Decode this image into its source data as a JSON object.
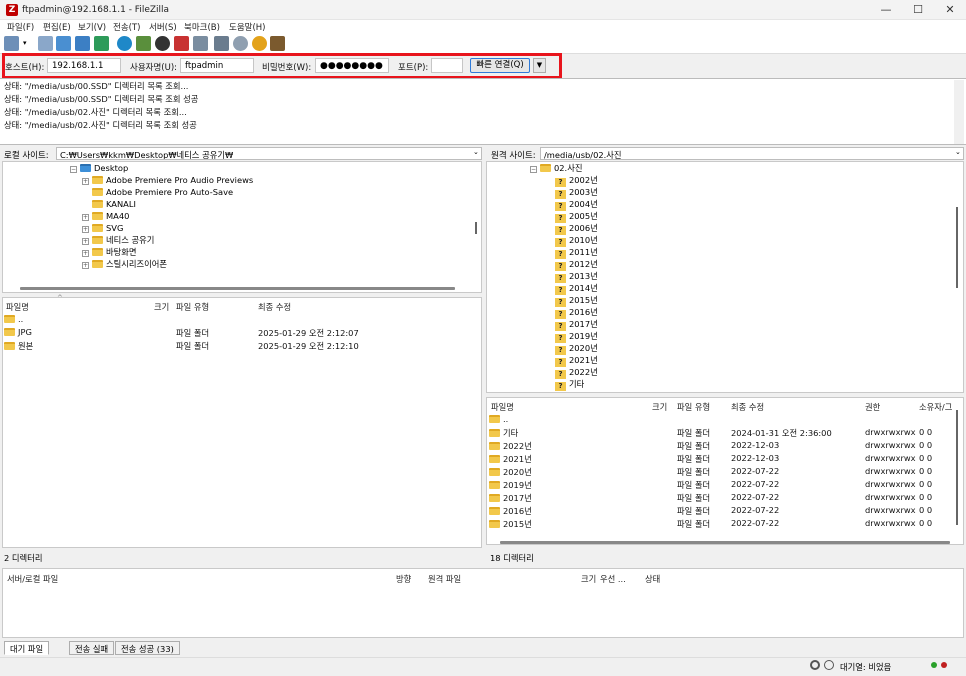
{
  "window": {
    "title": "ftpadmin@192.168.1.1 - FileZilla",
    "app_icon": "Z",
    "minimize": "—",
    "maximize": "☐",
    "close": "✕"
  },
  "menu": [
    "파일(F)",
    "편집(E)",
    "보기(V)",
    "전송(T)",
    "서버(S)",
    "북마크(B)",
    "도움말(H)"
  ],
  "quickconnect": {
    "host_label": "호스트(H):",
    "host_value": "192.168.1.1",
    "user_label": "사용자명(U):",
    "user_value": "ftpadmin",
    "pass_label": "비밀번호(W):",
    "pass_value": "●●●●●●●●",
    "port_label": "포트(P):",
    "port_value": "",
    "connect_label": "빠른 연결(Q)",
    "dropdown": "▼"
  },
  "log": [
    "상태:  \"/media/usb/00.SSD\" 디렉터리 목록 조회...",
    "상태:  \"/media/usb/00.SSD\" 디렉터리 목록 조회 성공",
    "상태:  \"/media/usb/02.사진\" 디렉터리 목록 조회...",
    "상태:  \"/media/usb/02.사진\" 디렉터리 목록 조회 성공"
  ],
  "local": {
    "site_label": "로컬 사이트:",
    "path": "C:₩Users₩kkm₩Desktop₩네티스 공유기₩",
    "tree": [
      {
        "label": "Desktop",
        "exp": "−",
        "indent": 0
      },
      {
        "label": "Adobe Premiere Pro Audio Previews",
        "exp": "+",
        "indent": 1
      },
      {
        "label": "Adobe Premiere Pro Auto-Save",
        "exp": "",
        "indent": 1
      },
      {
        "label": "KANALI",
        "exp": "",
        "indent": 1
      },
      {
        "label": "MA40",
        "exp": "+",
        "indent": 1
      },
      {
        "label": "SVG",
        "exp": "+",
        "indent": 1
      },
      {
        "label": "네티스 공유기",
        "exp": "+",
        "indent": 1
      },
      {
        "label": "바탕화면",
        "exp": "+",
        "indent": 1
      },
      {
        "label": "스틸시리즈이어폰",
        "exp": "+",
        "indent": 1
      }
    ],
    "columns": [
      "파일명",
      "크기",
      "파일 유형",
      "최종 수정"
    ],
    "files": [
      {
        "name": "..",
        "size": "",
        "type": "",
        "modified": ""
      },
      {
        "name": "JPG",
        "size": "",
        "type": "파일 폴더",
        "modified": "2025-01-29 오전 2:12:07"
      },
      {
        "name": "원본",
        "size": "",
        "type": "파일 폴더",
        "modified": "2025-01-29 오전 2:12:10"
      }
    ],
    "status": "2 디렉터리"
  },
  "remote": {
    "site_label": "원격 사이트:",
    "path": "/media/usb/02.사진",
    "tree_root": "02.사진",
    "tree": [
      "2002년",
      "2003년",
      "2004년",
      "2005년",
      "2006년",
      "2010년",
      "2011년",
      "2012년",
      "2013년",
      "2014년",
      "2015년",
      "2016년",
      "2017년",
      "2019년",
      "2020년",
      "2021년",
      "2022년",
      "기타"
    ],
    "columns": [
      "파일명",
      "크기",
      "파일 유형",
      "최종 수정",
      "권한",
      "소유자/그"
    ],
    "files": [
      {
        "name": "..",
        "size": "",
        "type": "",
        "modified": "",
        "perm": "",
        "owner": ""
      },
      {
        "name": "기타",
        "size": "",
        "type": "파일 폴더",
        "modified": "2024-01-31 오전 2:36:00",
        "perm": "drwxrwxrwx",
        "owner": "0 0"
      },
      {
        "name": "2022년",
        "size": "",
        "type": "파일 폴더",
        "modified": "2022-12-03",
        "perm": "drwxrwxrwx",
        "owner": "0 0"
      },
      {
        "name": "2021년",
        "size": "",
        "type": "파일 폴더",
        "modified": "2022-12-03",
        "perm": "drwxrwxrwx",
        "owner": "0 0"
      },
      {
        "name": "2020년",
        "size": "",
        "type": "파일 폴더",
        "modified": "2022-07-22",
        "perm": "drwxrwxrwx",
        "owner": "0 0"
      },
      {
        "name": "2019년",
        "size": "",
        "type": "파일 폴더",
        "modified": "2022-07-22",
        "perm": "drwxrwxrwx",
        "owner": "0 0"
      },
      {
        "name": "2017년",
        "size": "",
        "type": "파일 폴더",
        "modified": "2022-07-22",
        "perm": "drwxrwxrwx",
        "owner": "0 0"
      },
      {
        "name": "2016년",
        "size": "",
        "type": "파일 폴더",
        "modified": "2022-07-22",
        "perm": "drwxrwxrwx",
        "owner": "0 0"
      },
      {
        "name": "2015년",
        "size": "",
        "type": "파일 폴더",
        "modified": "2022-07-22",
        "perm": "drwxrwxrwx",
        "owner": "0 0"
      }
    ],
    "status": "18 디렉터리"
  },
  "queue": {
    "columns": [
      "서버/로컬 파일",
      "방향",
      "원격 파일",
      "크기",
      "우선 ...",
      "상태"
    ],
    "tabs": [
      "대기 파일",
      "전송 실패",
      "전송 성공 (33)"
    ]
  },
  "statusbar": {
    "queue_text": "대기열: 비었음"
  },
  "colors": {
    "accent": "#e8141c",
    "folder": "#f2c84b",
    "brand": "#bf0000"
  }
}
